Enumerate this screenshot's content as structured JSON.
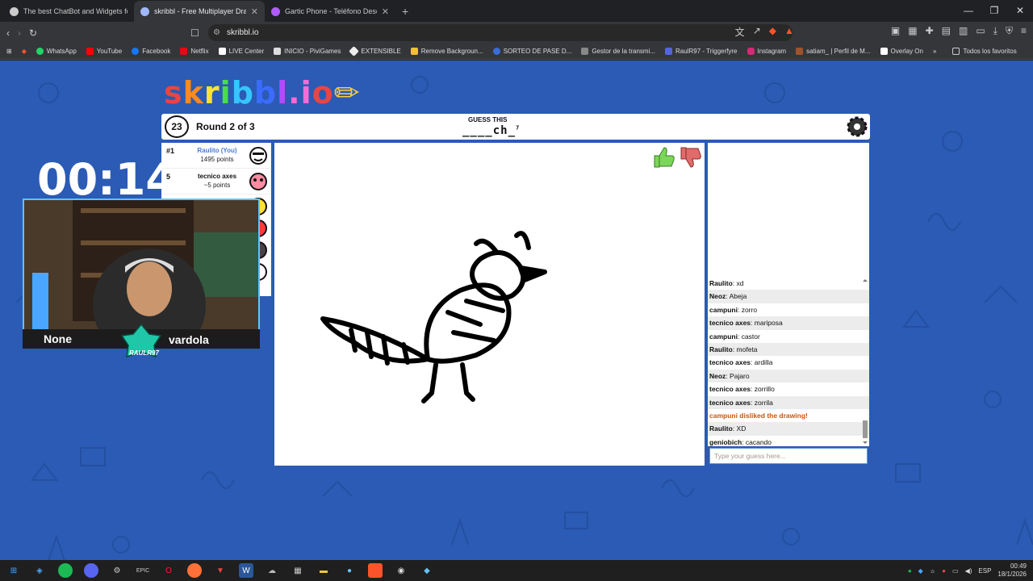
{
  "browser": {
    "tabs": [
      {
        "title": "The best ChatBot and Widgets for Kick",
        "color": "#cccccc",
        "active": false
      },
      {
        "title": "skribbl - Free Multiplayer Drawing",
        "color": "#a0b8ff",
        "active": true
      },
      {
        "title": "Gartic Phone - Teléfono Descompuesto",
        "color": "#b15cff",
        "active": false
      }
    ],
    "new_tab": "+",
    "url": "skribbl.io",
    "bookmarks": [
      {
        "label": "WhatsApp",
        "color": "#25d366"
      },
      {
        "label": "YouTube",
        "color": "#ff0000"
      },
      {
        "label": "Facebook",
        "color": "#1877f2"
      },
      {
        "label": "Netflix",
        "color": "#e50914"
      },
      {
        "label": "LIVE Center",
        "color": "#ffffff"
      },
      {
        "label": "INICIO - PiviGames",
        "color": "#dddddd"
      },
      {
        "label": "EXTENSIBLE",
        "color": "#eeeeee"
      },
      {
        "label": "Remove Backgroun...",
        "color": "#f6c12f"
      },
      {
        "label": "SORTEO DE PASE D...",
        "color": "#3b6dd9"
      },
      {
        "label": "Gestor de la transmi...",
        "color": "#888888"
      },
      {
        "label": "RaulR97 - Triggerfyre",
        "color": "#5566dd"
      },
      {
        "label": "Instagram",
        "color": "#d62976"
      },
      {
        "label": "satiam_ | Perfil de M...",
        "color": "#a0522d"
      },
      {
        "label": "Overlay On",
        "color": "#ffffff"
      }
    ],
    "bookmarks_more": "»",
    "all_bookmarks": "Todos los favoritos"
  },
  "game": {
    "logo": "skribbl.io",
    "timer": "23",
    "round": "Round 2 of 3",
    "guess_label": "GUESS THIS",
    "word": "____ch_",
    "word_length": "7",
    "players": [
      {
        "rank": "#1",
        "name": "Raulito (You)",
        "points": "1495 points",
        "highlight": true
      },
      {
        "rank": "5",
        "name": "tecnico axes",
        "points": "~5 points",
        "highlight": false
      }
    ],
    "hint_bubble": "cacando",
    "chat": [
      {
        "user": "Raulito",
        "text": "xd"
      },
      {
        "user": "Neoz",
        "text": "Abeja"
      },
      {
        "user": "campuni",
        "text": "zorro"
      },
      {
        "user": "tecnico axes",
        "text": "mariposa"
      },
      {
        "user": "campuni",
        "text": "castor"
      },
      {
        "user": "Raulito",
        "text": "mofeta"
      },
      {
        "user": "tecnico axes",
        "text": "ardilla"
      },
      {
        "user": "Neoz",
        "text": "Pajaro"
      },
      {
        "user": "tecnico axes",
        "text": "zorrillo"
      },
      {
        "user": "tecnico axes",
        "text": "zorrila"
      },
      {
        "system": "campuni disliked the drawing!"
      },
      {
        "user": "Raulito",
        "text": "XD"
      },
      {
        "user": "geniobich",
        "text": "cacando"
      }
    ],
    "chat_placeholder": "Type your guess here..."
  },
  "overlay": {
    "big_timer": "00:14",
    "cam_left_name": "None",
    "cam_right_name": "vardola",
    "cam_brand": "RAULR97"
  },
  "taskbar": {
    "lang": "ESP",
    "time": "00:49",
    "date": "18/1/2026"
  }
}
